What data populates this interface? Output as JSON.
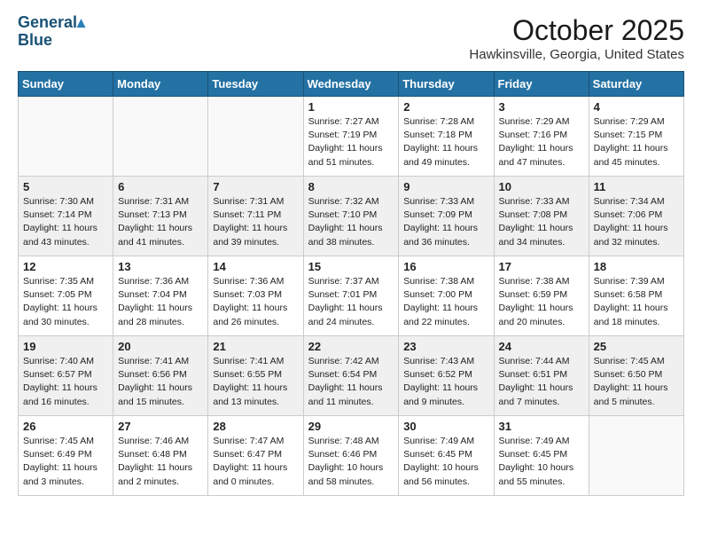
{
  "header": {
    "logo_line1": "General",
    "logo_line2": "Blue",
    "month": "October 2025",
    "location": "Hawkinsville, Georgia, United States"
  },
  "weekdays": [
    "Sunday",
    "Monday",
    "Tuesday",
    "Wednesday",
    "Thursday",
    "Friday",
    "Saturday"
  ],
  "weeks": [
    [
      {
        "day": "",
        "info": ""
      },
      {
        "day": "",
        "info": ""
      },
      {
        "day": "",
        "info": ""
      },
      {
        "day": "1",
        "info": "Sunrise: 7:27 AM\nSunset: 7:19 PM\nDaylight: 11 hours\nand 51 minutes."
      },
      {
        "day": "2",
        "info": "Sunrise: 7:28 AM\nSunset: 7:18 PM\nDaylight: 11 hours\nand 49 minutes."
      },
      {
        "day": "3",
        "info": "Sunrise: 7:29 AM\nSunset: 7:16 PM\nDaylight: 11 hours\nand 47 minutes."
      },
      {
        "day": "4",
        "info": "Sunrise: 7:29 AM\nSunset: 7:15 PM\nDaylight: 11 hours\nand 45 minutes."
      }
    ],
    [
      {
        "day": "5",
        "info": "Sunrise: 7:30 AM\nSunset: 7:14 PM\nDaylight: 11 hours\nand 43 minutes."
      },
      {
        "day": "6",
        "info": "Sunrise: 7:31 AM\nSunset: 7:13 PM\nDaylight: 11 hours\nand 41 minutes."
      },
      {
        "day": "7",
        "info": "Sunrise: 7:31 AM\nSunset: 7:11 PM\nDaylight: 11 hours\nand 39 minutes."
      },
      {
        "day": "8",
        "info": "Sunrise: 7:32 AM\nSunset: 7:10 PM\nDaylight: 11 hours\nand 38 minutes."
      },
      {
        "day": "9",
        "info": "Sunrise: 7:33 AM\nSunset: 7:09 PM\nDaylight: 11 hours\nand 36 minutes."
      },
      {
        "day": "10",
        "info": "Sunrise: 7:33 AM\nSunset: 7:08 PM\nDaylight: 11 hours\nand 34 minutes."
      },
      {
        "day": "11",
        "info": "Sunrise: 7:34 AM\nSunset: 7:06 PM\nDaylight: 11 hours\nand 32 minutes."
      }
    ],
    [
      {
        "day": "12",
        "info": "Sunrise: 7:35 AM\nSunset: 7:05 PM\nDaylight: 11 hours\nand 30 minutes."
      },
      {
        "day": "13",
        "info": "Sunrise: 7:36 AM\nSunset: 7:04 PM\nDaylight: 11 hours\nand 28 minutes."
      },
      {
        "day": "14",
        "info": "Sunrise: 7:36 AM\nSunset: 7:03 PM\nDaylight: 11 hours\nand 26 minutes."
      },
      {
        "day": "15",
        "info": "Sunrise: 7:37 AM\nSunset: 7:01 PM\nDaylight: 11 hours\nand 24 minutes."
      },
      {
        "day": "16",
        "info": "Sunrise: 7:38 AM\nSunset: 7:00 PM\nDaylight: 11 hours\nand 22 minutes."
      },
      {
        "day": "17",
        "info": "Sunrise: 7:38 AM\nSunset: 6:59 PM\nDaylight: 11 hours\nand 20 minutes."
      },
      {
        "day": "18",
        "info": "Sunrise: 7:39 AM\nSunset: 6:58 PM\nDaylight: 11 hours\nand 18 minutes."
      }
    ],
    [
      {
        "day": "19",
        "info": "Sunrise: 7:40 AM\nSunset: 6:57 PM\nDaylight: 11 hours\nand 16 minutes."
      },
      {
        "day": "20",
        "info": "Sunrise: 7:41 AM\nSunset: 6:56 PM\nDaylight: 11 hours\nand 15 minutes."
      },
      {
        "day": "21",
        "info": "Sunrise: 7:41 AM\nSunset: 6:55 PM\nDaylight: 11 hours\nand 13 minutes."
      },
      {
        "day": "22",
        "info": "Sunrise: 7:42 AM\nSunset: 6:54 PM\nDaylight: 11 hours\nand 11 minutes."
      },
      {
        "day": "23",
        "info": "Sunrise: 7:43 AM\nSunset: 6:52 PM\nDaylight: 11 hours\nand 9 minutes."
      },
      {
        "day": "24",
        "info": "Sunrise: 7:44 AM\nSunset: 6:51 PM\nDaylight: 11 hours\nand 7 minutes."
      },
      {
        "day": "25",
        "info": "Sunrise: 7:45 AM\nSunset: 6:50 PM\nDaylight: 11 hours\nand 5 minutes."
      }
    ],
    [
      {
        "day": "26",
        "info": "Sunrise: 7:45 AM\nSunset: 6:49 PM\nDaylight: 11 hours\nand 3 minutes."
      },
      {
        "day": "27",
        "info": "Sunrise: 7:46 AM\nSunset: 6:48 PM\nDaylight: 11 hours\nand 2 minutes."
      },
      {
        "day": "28",
        "info": "Sunrise: 7:47 AM\nSunset: 6:47 PM\nDaylight: 11 hours\nand 0 minutes."
      },
      {
        "day": "29",
        "info": "Sunrise: 7:48 AM\nSunset: 6:46 PM\nDaylight: 10 hours\nand 58 minutes."
      },
      {
        "day": "30",
        "info": "Sunrise: 7:49 AM\nSunset: 6:45 PM\nDaylight: 10 hours\nand 56 minutes."
      },
      {
        "day": "31",
        "info": "Sunrise: 7:49 AM\nSunset: 6:45 PM\nDaylight: 10 hours\nand 55 minutes."
      },
      {
        "day": "",
        "info": ""
      }
    ]
  ]
}
